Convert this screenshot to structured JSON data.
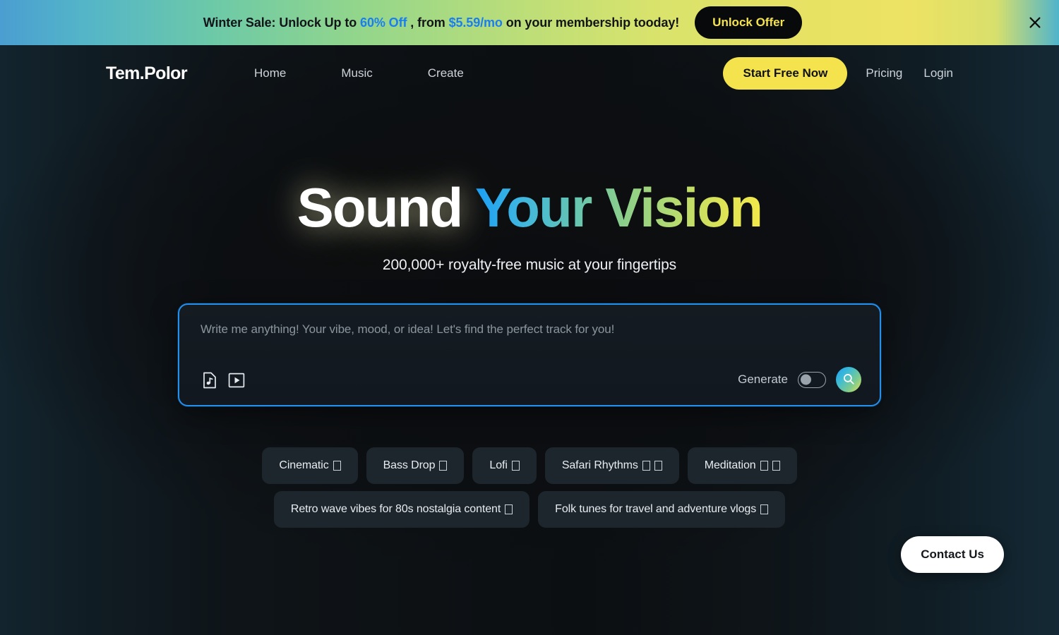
{
  "promo": {
    "text_before": "Winter Sale: Unlock Up to ",
    "discount": "60% Off",
    "text_middle": " , from ",
    "price": "$5.59/mo",
    "text_after": " on your membership tooday!",
    "button_label": "Unlock Offer",
    "close_icon": "close-icon",
    "colors": {
      "highlight": "#1b7ef0",
      "button_bg": "#08090b",
      "button_text": "#f5e34e"
    }
  },
  "nav": {
    "logo": "Tem.Polor",
    "links": [
      {
        "label": "Home"
      },
      {
        "label": "Music"
      },
      {
        "label": "Create"
      }
    ],
    "cta_label": "Start Free Now",
    "right_links": [
      {
        "label": "Pricing"
      },
      {
        "label": "Login"
      }
    ],
    "colors": {
      "cta_bg": "#f5e34e"
    }
  },
  "hero": {
    "headline_white": "Sound",
    "headline_gradient": "Your Vision",
    "subheadline": "200,000+ royalty-free music at your fingertips",
    "gradient_colors": [
      "#1b9ff5",
      "#63c4b4",
      "#8ccf8a",
      "#f3e84a"
    ]
  },
  "search": {
    "placeholder": "Write me anything! Your vibe, mood, or idea! Let's find the perfect track for you!",
    "audio_icon": "audio-file-icon",
    "video_icon": "video-file-icon",
    "generate_label": "Generate",
    "generate_enabled": false,
    "search_icon": "search-icon",
    "border_color": "#2390ee"
  },
  "suggestions": {
    "row1": [
      {
        "label": "Cinematic",
        "emoji": "�"
      },
      {
        "label": "Bass Drop",
        "emoji": "�"
      },
      {
        "label": "Lofi",
        "emoji": "�"
      },
      {
        "label": "Safari Rhythms",
        "emoji": "��"
      },
      {
        "label": "Meditation",
        "emoji": "��"
      }
    ],
    "row2": [
      {
        "label": "Retro wave vibes for 80s nostalgia content",
        "emoji": "�"
      },
      {
        "label": "Folk tunes for travel and adventure vlogs",
        "emoji": "�"
      }
    ]
  },
  "contact": {
    "label": "Contact Us"
  }
}
